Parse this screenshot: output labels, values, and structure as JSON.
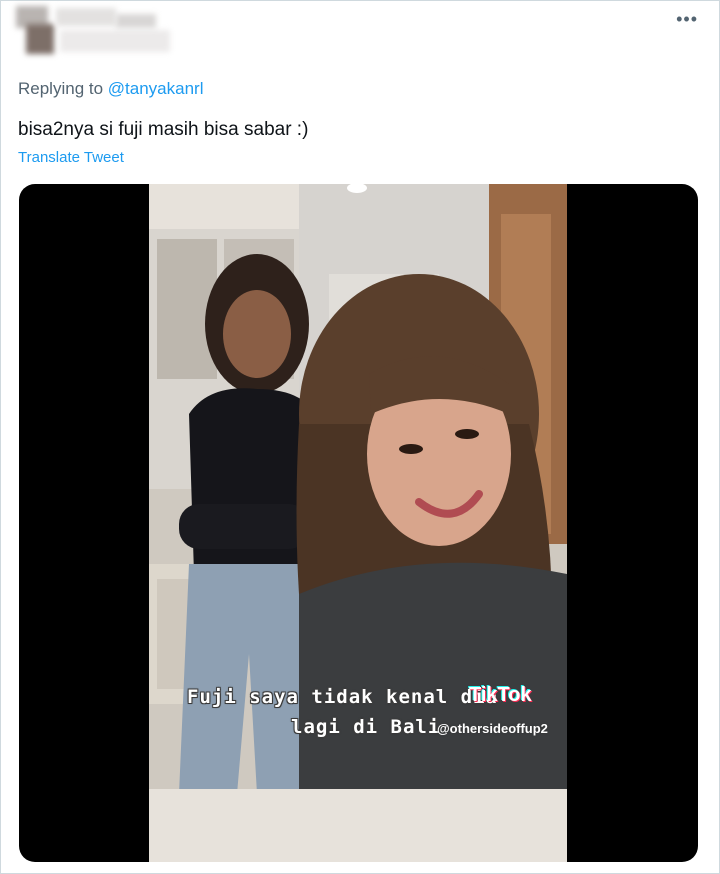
{
  "tweet": {
    "more_icon": "more-horizontal-icon",
    "more_label": "•••",
    "reply_prefix": "Replying to",
    "reply_handle": "@tanyakanrl",
    "text": "bisa2nya si fuji masih bisa sabar :)",
    "translate_label": "Translate Tweet"
  },
  "media": {
    "caption_line1": "Fuji saya tidak kenal dia",
    "caption_line2": "lagi di Bali",
    "tiktok_logo": "TikTok",
    "tiktok_handle": "@othersideoffup2"
  }
}
